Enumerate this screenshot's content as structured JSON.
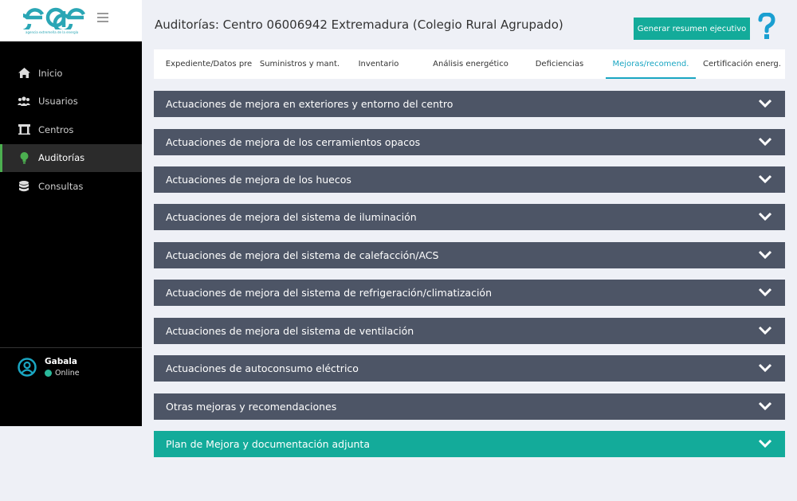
{
  "brand": {
    "logo_text": "eae",
    "tagline": "agencia extremeña de la energía",
    "colors": {
      "teal": "#13ab9a",
      "accordion": "#4d5566",
      "active_tab": "#1aa6c2",
      "sidebar_active_bar": "#4caf50"
    }
  },
  "sidebar": {
    "items": [
      {
        "label": "Inicio",
        "icon": "home-icon"
      },
      {
        "label": "Usuarios",
        "icon": "users-icon"
      },
      {
        "label": "Centros",
        "icon": "building-icon"
      },
      {
        "label": "Auditorías",
        "icon": "lightbulb-icon",
        "active": true
      },
      {
        "label": "Consultas",
        "icon": "database-icon"
      }
    ],
    "user": {
      "name": "Gabala",
      "status": "Online"
    }
  },
  "header": {
    "title": "Auditorías: Centro 06006942 Extremadura (Colegio Rural Agrupado)",
    "exec_button": "Generar resumen ejecutivo"
  },
  "tabs": [
    {
      "label": "Expediente/Datos pre"
    },
    {
      "label": "Suministros y mant."
    },
    {
      "label": "Inventario"
    },
    {
      "label": "Análisis energético"
    },
    {
      "label": "Deficiencias"
    },
    {
      "label": "Mejoras/recomend.",
      "active": true
    },
    {
      "label": "Certificación energ."
    }
  ],
  "sections": [
    {
      "label": "Actuaciones de mejora en exteriores y entorno del centro"
    },
    {
      "label": "Actuaciones de mejora de los cerramientos opacos"
    },
    {
      "label": "Actuaciones de mejora de los huecos"
    },
    {
      "label": "Actuaciones de mejora del sistema de iluminación"
    },
    {
      "label": "Actuaciones de mejora del sistema de calefacción/ACS"
    },
    {
      "label": "Actuaciones de mejora del sistema de refrigeración/climatización"
    },
    {
      "label": "Actuaciones de mejora del sistema de ventilación"
    },
    {
      "label": "Actuaciones de autoconsumo eléctrico"
    },
    {
      "label": "Otras mejoras y recomendaciones"
    },
    {
      "label": "Plan de Mejora y documentación adjunta",
      "highlight": true
    }
  ]
}
